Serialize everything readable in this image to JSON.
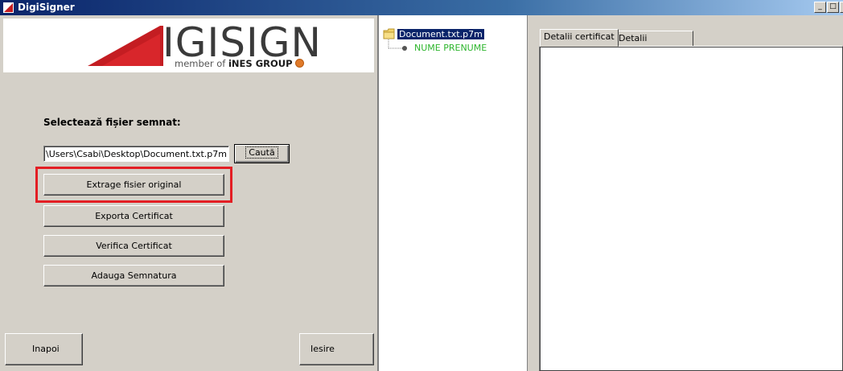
{
  "window": {
    "title": "DigiSigner",
    "minimize_label": "_",
    "maximize_label": "□",
    "close_label": "x"
  },
  "logo": {
    "wordmark": "IGISIGN",
    "tagline_prefix": "member of",
    "tagline_brand": "iNES GROUP"
  },
  "form": {
    "section_label": "Selectează fișier semnat:",
    "file_path": "\\Users\\Csabi\\Desktop\\Document.txt.p7m",
    "search_button": "Caută",
    "extract_button": "Extrage fisier original",
    "export_button": "Exporta Certificat",
    "verify_button": "Verifica Certificat",
    "add_signature_button": "Adauga Semnatura",
    "back_button": "Inapoi",
    "exit_button": "Iesire"
  },
  "tree": {
    "root": "Document.txt.p7m",
    "child": "NUME PRENUME"
  },
  "tabs": [
    {
      "label": "Detalii certificat",
      "active": true
    },
    {
      "label": "Detalii complete",
      "active": false
    }
  ],
  "colors": {
    "highlight": "#e31e24",
    "brand_red": "#c41d22",
    "selection": "#0a246a",
    "signer_green": "#2db52d"
  }
}
